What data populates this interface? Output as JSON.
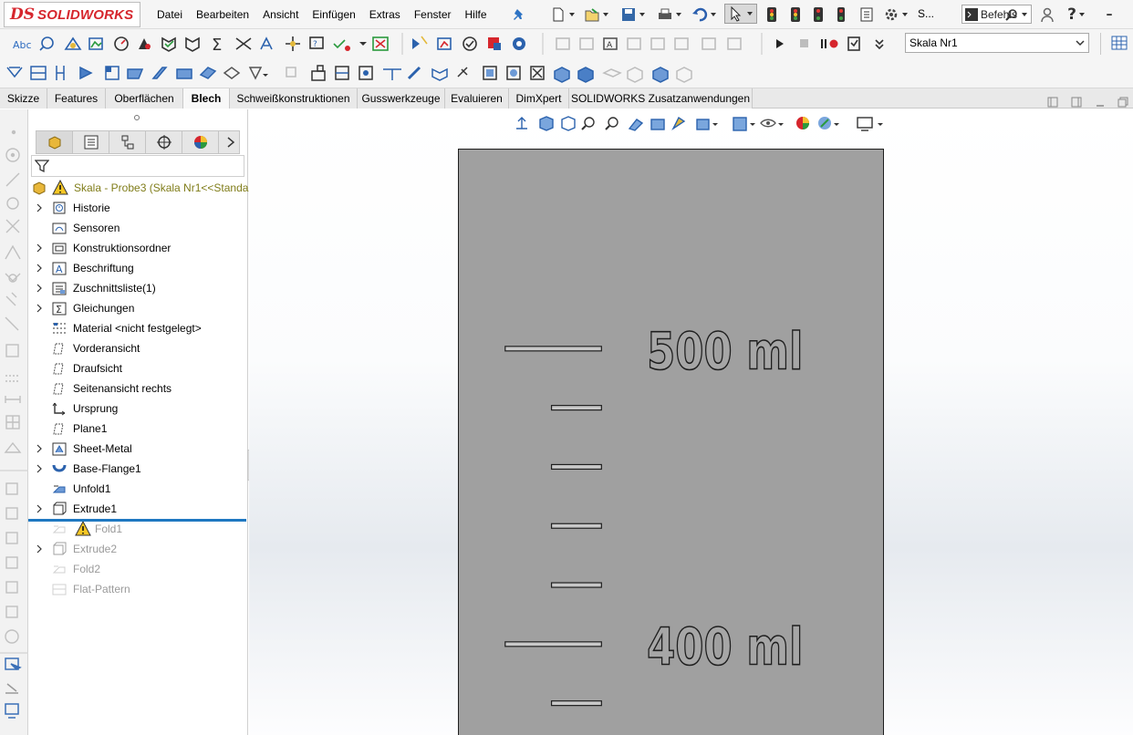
{
  "app": {
    "brand_prefix": "DS",
    "brand_name": "SOLIDWORKS"
  },
  "menu": [
    "Datei",
    "Bearbeiten",
    "Ansicht",
    "Einfügen",
    "Extras",
    "Fenster",
    "Hilfe"
  ],
  "topbar": {
    "search_truncated_label": "S...",
    "search_placeholder": "Befehls"
  },
  "config_dropdown": {
    "value": "Skala Nr1"
  },
  "tabs": [
    {
      "label": "Skizze",
      "active": false
    },
    {
      "label": "Features",
      "active": false
    },
    {
      "label": "Oberflächen",
      "active": false
    },
    {
      "label": "Blech",
      "active": true
    },
    {
      "label": "Schweißkonstruktionen",
      "active": false
    },
    {
      "label": "Gusswerkzeuge",
      "active": false
    },
    {
      "label": "Evaluieren",
      "active": false
    },
    {
      "label": "DimXpert",
      "active": false
    },
    {
      "label": "SOLIDWORKS Zusatzanwendungen",
      "active": false
    }
  ],
  "feature_tree": {
    "root": "Skala - Probe3  (Skala Nr1<<Standar",
    "items": [
      {
        "label": "Historie",
        "expandable": true,
        "suppressed": false,
        "icon": "history-icon"
      },
      {
        "label": "Sensoren",
        "expandable": false,
        "suppressed": false,
        "icon": "sensor-folder-icon"
      },
      {
        "label": "Konstruktionsordner",
        "expandable": true,
        "suppressed": false,
        "icon": "folder-icon"
      },
      {
        "label": "Beschriftung",
        "expandable": true,
        "suppressed": false,
        "icon": "annotation-icon"
      },
      {
        "label": "Zuschnittsliste(1)",
        "expandable": true,
        "suppressed": false,
        "icon": "cut-list-icon"
      },
      {
        "label": "Gleichungen",
        "expandable": true,
        "suppressed": false,
        "icon": "equations-icon"
      },
      {
        "label": "Material <nicht festgelegt>",
        "expandable": false,
        "suppressed": false,
        "icon": "material-icon"
      },
      {
        "label": "Vorderansicht",
        "expandable": false,
        "suppressed": false,
        "icon": "plane-icon"
      },
      {
        "label": "Draufsicht",
        "expandable": false,
        "suppressed": false,
        "icon": "plane-icon"
      },
      {
        "label": "Seitenansicht rechts",
        "expandable": false,
        "suppressed": false,
        "icon": "plane-icon"
      },
      {
        "label": "Ursprung",
        "expandable": false,
        "suppressed": false,
        "icon": "origin-icon"
      },
      {
        "label": "Plane1",
        "expandable": false,
        "suppressed": false,
        "icon": "plane-icon"
      },
      {
        "label": "Sheet-Metal",
        "expandable": true,
        "suppressed": false,
        "icon": "sheet-metal-icon"
      },
      {
        "label": "Base-Flange1",
        "expandable": true,
        "suppressed": false,
        "icon": "base-flange-icon"
      },
      {
        "label": "Unfold1",
        "expandable": false,
        "suppressed": false,
        "icon": "unfold-icon"
      },
      {
        "label": "Extrude1",
        "expandable": true,
        "suppressed": false,
        "icon": "extrude-icon"
      },
      {
        "label": "Fold1",
        "expandable": false,
        "suppressed": true,
        "icon": "fold-icon",
        "warning": true
      },
      {
        "label": "Extrude2",
        "expandable": true,
        "suppressed": true,
        "icon": "extrude-icon"
      },
      {
        "label": "Fold2",
        "expandable": false,
        "suppressed": true,
        "icon": "fold-icon"
      },
      {
        "label": "Flat-Pattern",
        "expandable": false,
        "suppressed": true,
        "icon": "flat-pattern-icon"
      }
    ]
  },
  "model": {
    "labels": [
      "500 ml",
      "400 ml"
    ],
    "plate_color": "#a0a0a0"
  },
  "colors": {
    "accent_blue": "#1f78c1",
    "brand_red": "#d6262d",
    "tree_root_olive": "#807d1a"
  }
}
